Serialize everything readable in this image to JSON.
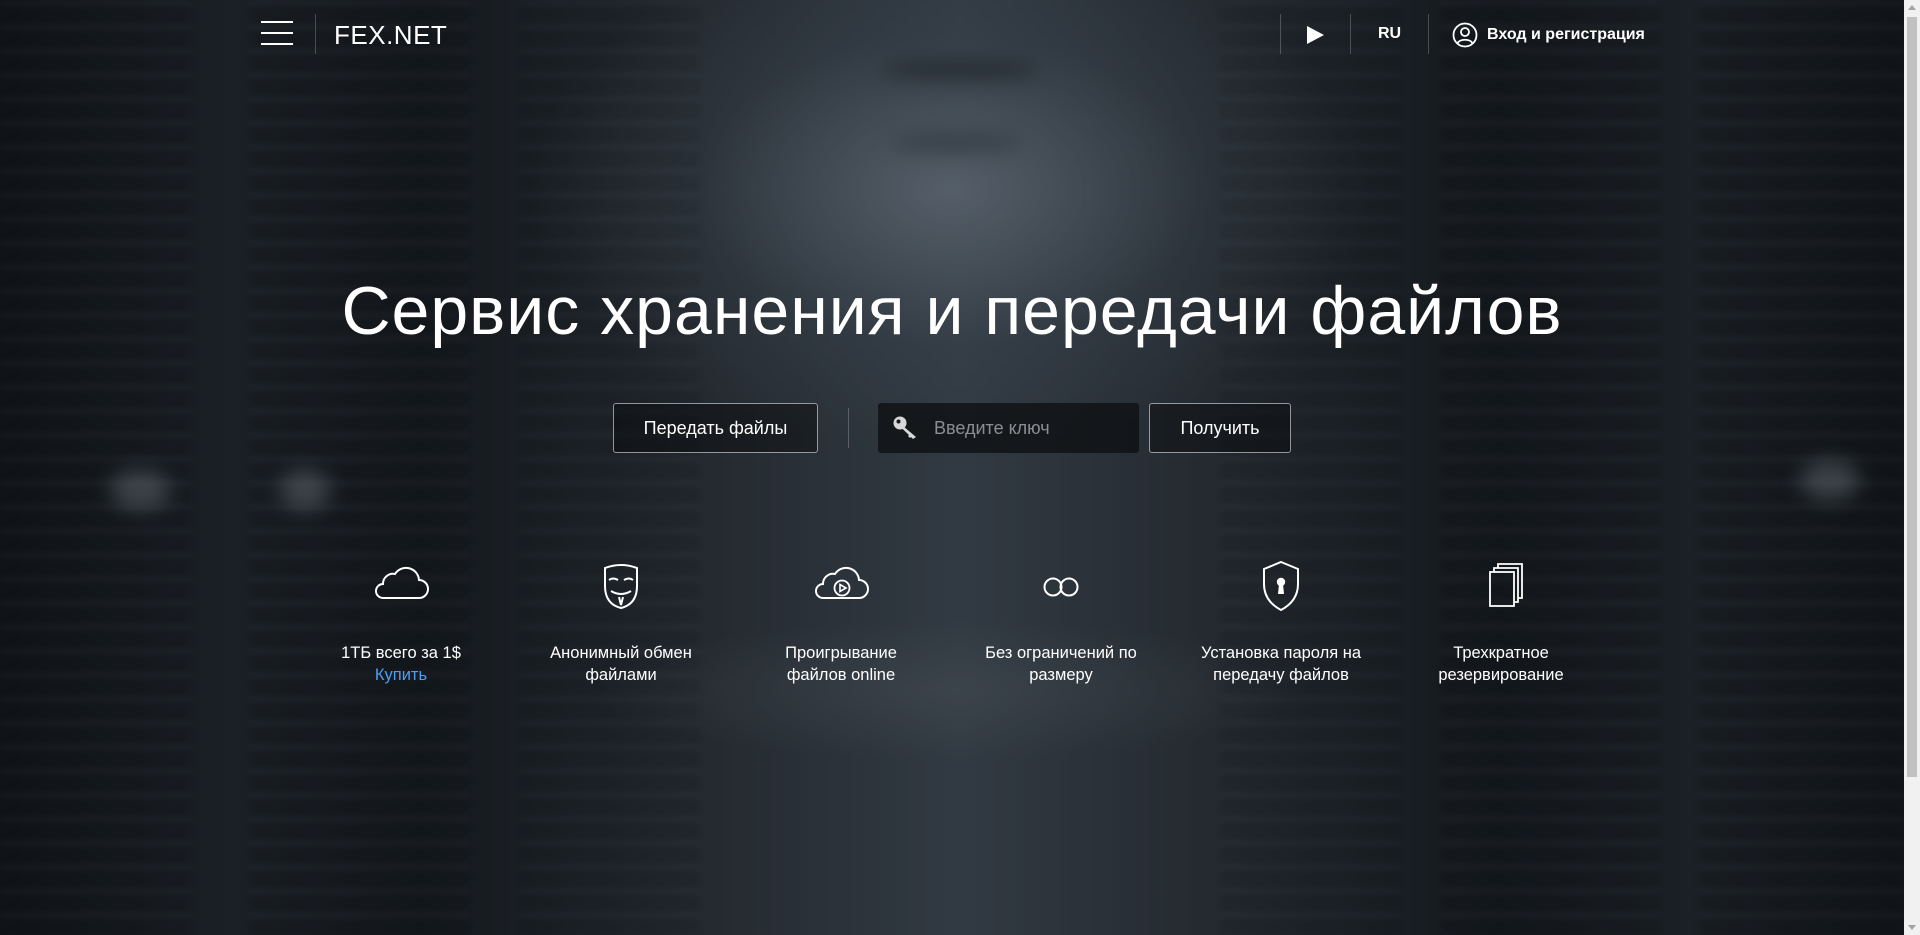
{
  "header": {
    "logo": "FEX.NET",
    "lang": "RU",
    "login_label": "Вход и регистрация"
  },
  "hero": {
    "title": "Сервис хранения и передачи файлов",
    "send_button": "Передать файлы",
    "key_placeholder": "Введите ключ",
    "get_button": "Получить"
  },
  "features": [
    {
      "icon": "cloud-icon",
      "label": "1ТБ всего за 1$",
      "link": "Купить"
    },
    {
      "icon": "anonymous-mask-icon",
      "label_line1": "Анонимный обмен",
      "label_line2": "файлами"
    },
    {
      "icon": "cloud-play-icon",
      "label_line1": "Проигрывание",
      "label_line2": "файлов online"
    },
    {
      "icon": "infinity-icon",
      "label_line1": "Без ограничений по",
      "label_line2": "размеру"
    },
    {
      "icon": "shield-lock-icon",
      "label_line1": "Установка пароля на",
      "label_line2": "передачу файлов"
    },
    {
      "icon": "copies-icon",
      "label_line1": "Трехкратное",
      "label_line2": "резервирование"
    }
  ],
  "colors": {
    "link": "#4a9ff5",
    "text": "#ffffff"
  }
}
